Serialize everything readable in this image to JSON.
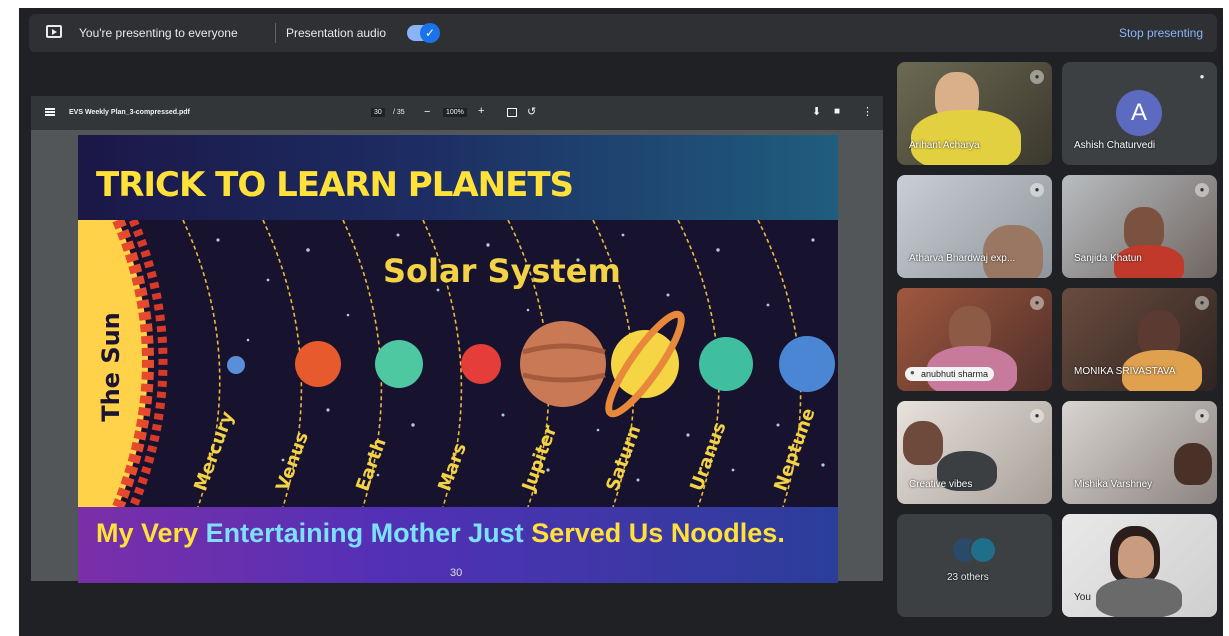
{
  "topbar": {
    "presenting_text": "You're presenting to everyone",
    "audio_label": "Presentation audio",
    "audio_on": true,
    "stop_label": "Stop presenting"
  },
  "pdf_toolbar": {
    "file_name": "EVS Weekly Plan_3-compressed.pdf",
    "page_current": "30",
    "page_total": "/ 35",
    "zoom": "100%"
  },
  "slide": {
    "title": "TRICK TO LEARN PLANETS",
    "subtitle": "Solar System",
    "sun_label": "The Sun",
    "planets": [
      "Mercury",
      "Venus",
      "Earth",
      "Mars",
      "Jupiter",
      "Saturn",
      "Uranus",
      "Neptune"
    ],
    "mnemonic_words": [
      "My",
      "Very",
      "Entertaining",
      "Mother",
      "Just",
      "Served",
      "Us",
      "Noodles."
    ],
    "page_number": "30"
  },
  "participants": [
    {
      "name": "Arihant Acharya"
    },
    {
      "name": "Ashish Chaturvedi",
      "initial": "A"
    },
    {
      "name": "Atharva Bhardwaj exp..."
    },
    {
      "name": "Sanjida Khatun"
    },
    {
      "name": "anubhuti sharma"
    },
    {
      "name": "MONIKA SRIVASTAVA"
    },
    {
      "name": "Creative vibes"
    },
    {
      "name": "Mishika Varshney"
    },
    {
      "name": "23 others"
    },
    {
      "name": "You"
    }
  ],
  "colors": {
    "meet_bg": "#202124",
    "accent": "#8ab4f8",
    "title_yellow": "#ffe13a"
  }
}
